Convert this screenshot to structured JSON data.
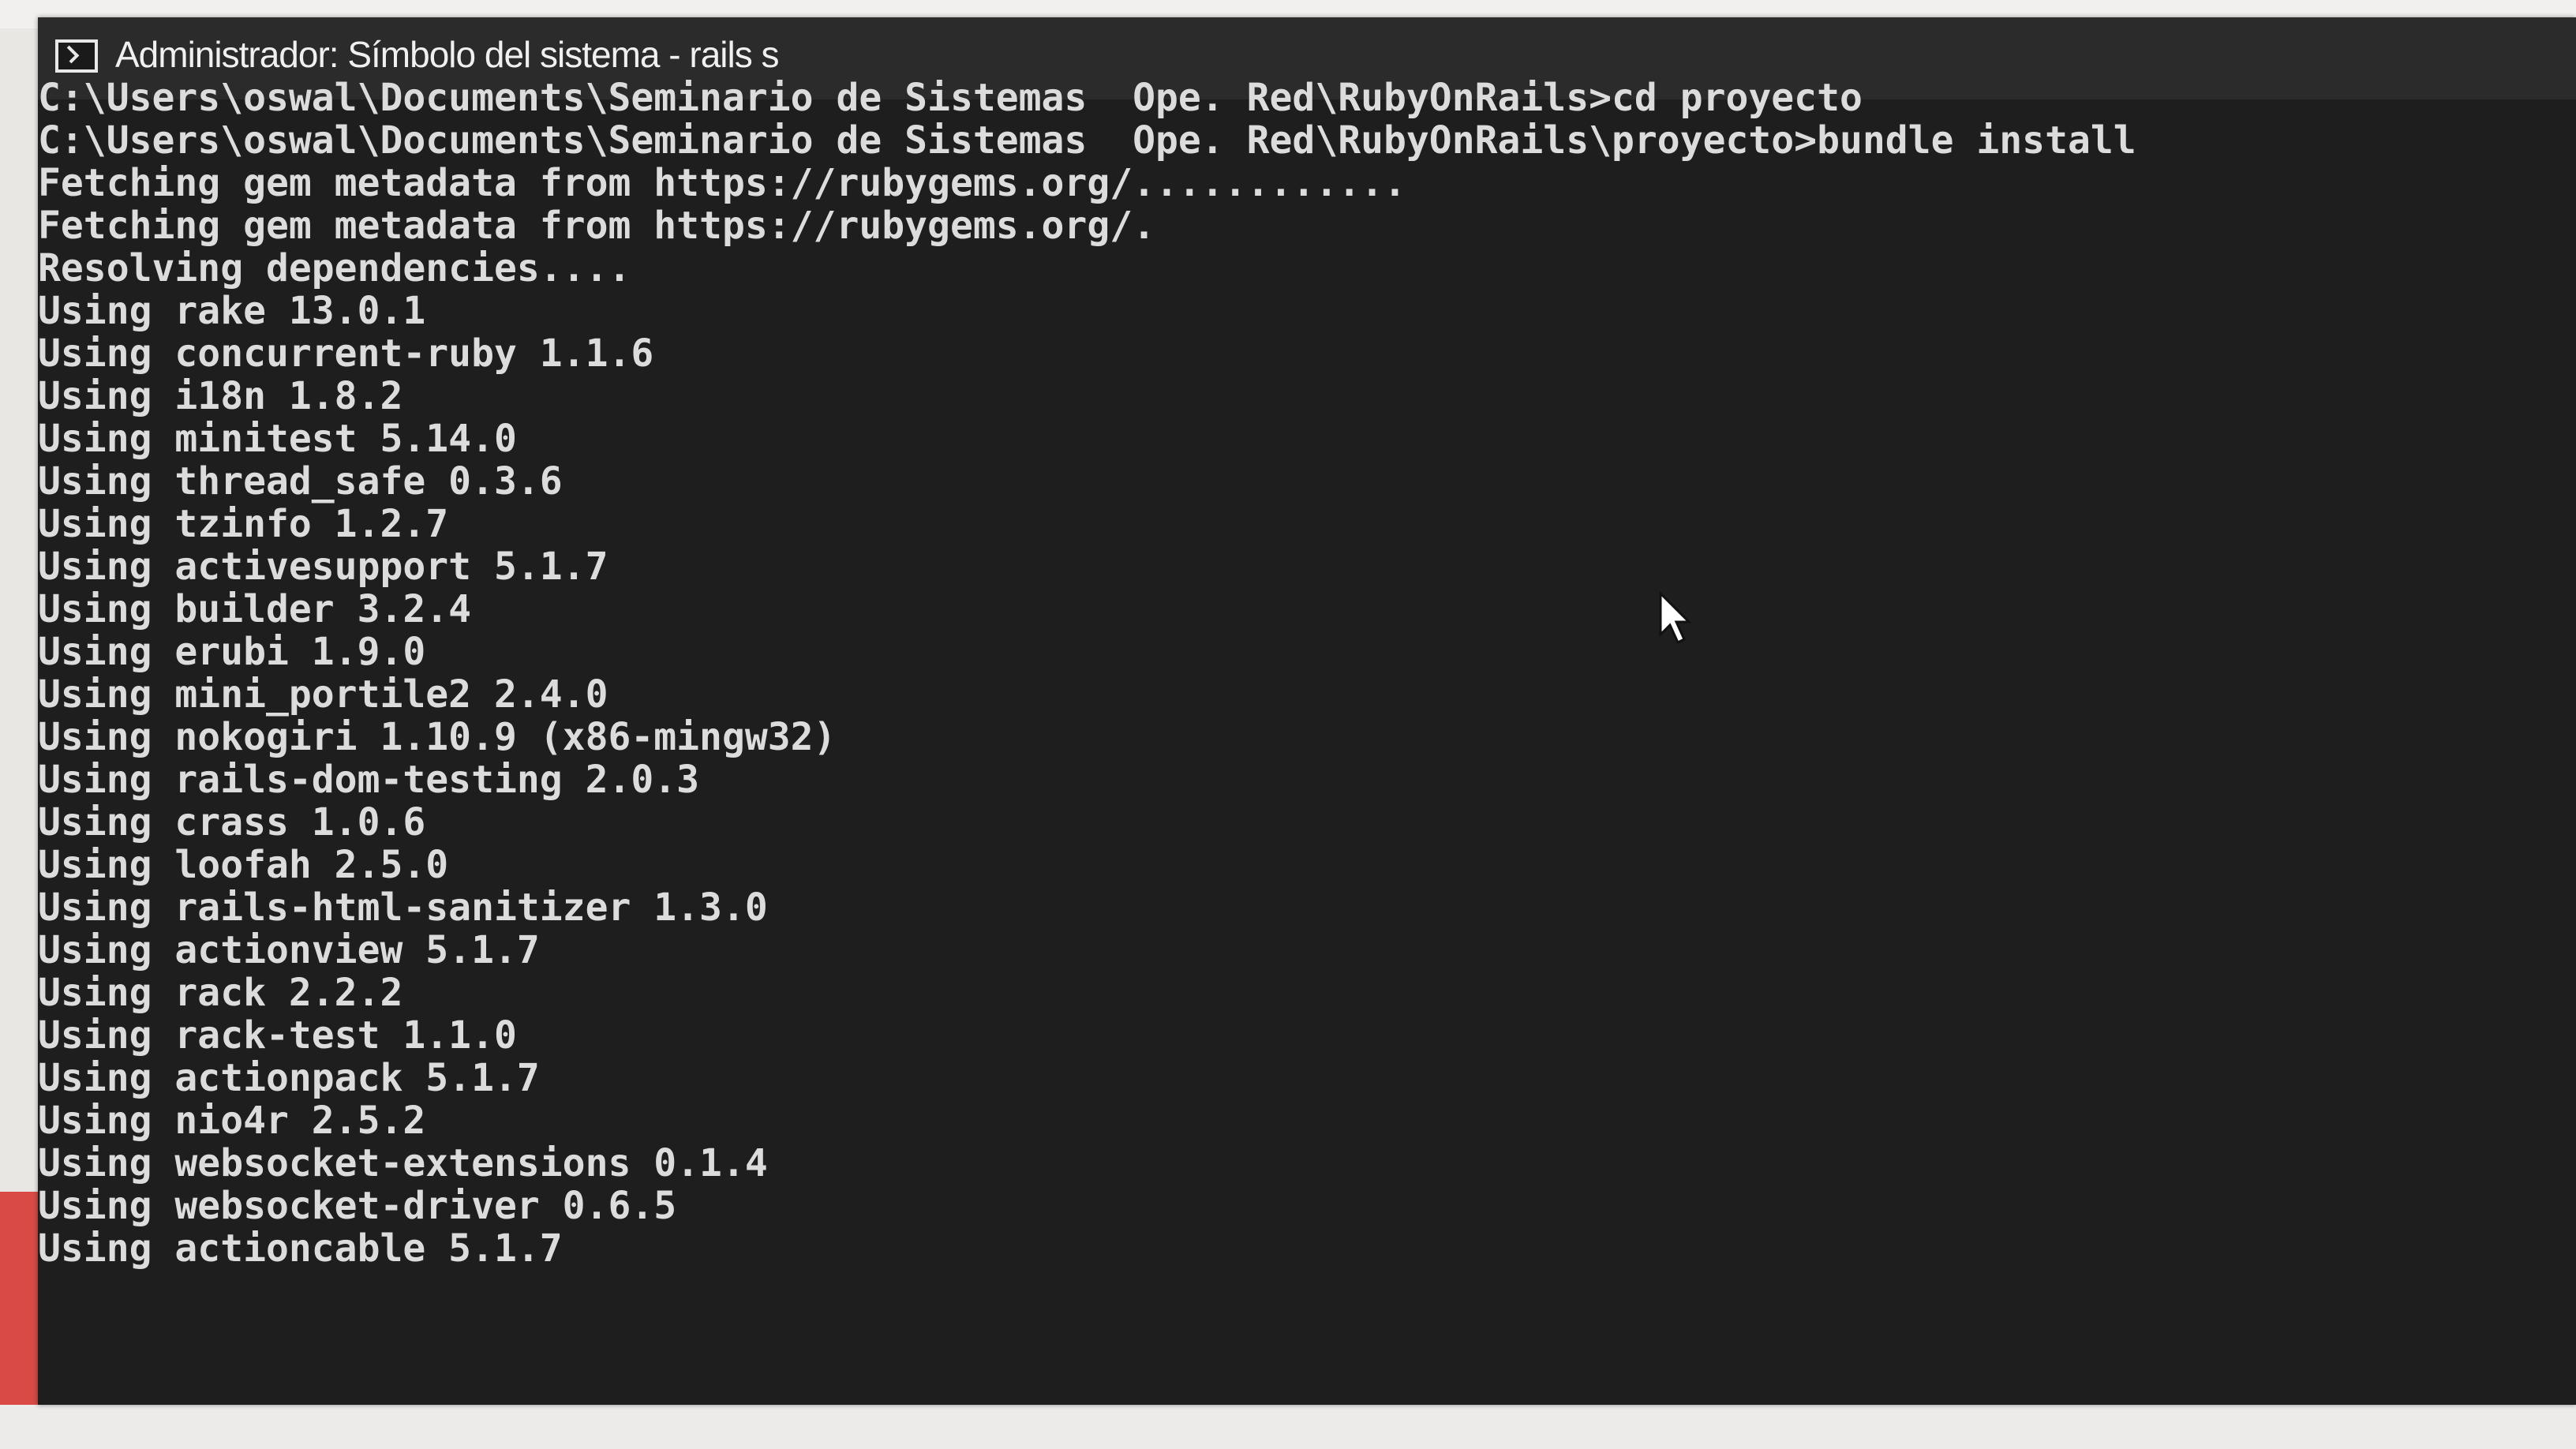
{
  "window": {
    "title": "Administrador: Símbolo del sistema - rails s"
  },
  "console": {
    "lines": [
      "C:\\Users\\oswal\\Documents\\Seminario de Sistemas  Ope. Red\\RubyOnRails>cd proyecto",
      "",
      "C:\\Users\\oswal\\Documents\\Seminario de Sistemas  Ope. Red\\RubyOnRails\\proyecto>bundle install",
      "Fetching gem metadata from https://rubygems.org/............",
      "Fetching gem metadata from https://rubygems.org/.",
      "Resolving dependencies....",
      "Using rake 13.0.1",
      "Using concurrent-ruby 1.1.6",
      "Using i18n 1.8.2",
      "Using minitest 5.14.0",
      "Using thread_safe 0.3.6",
      "Using tzinfo 1.2.7",
      "Using activesupport 5.1.7",
      "Using builder 3.2.4",
      "Using erubi 1.9.0",
      "Using mini_portile2 2.4.0",
      "Using nokogiri 1.10.9 (x86-mingw32)",
      "Using rails-dom-testing 2.0.3",
      "Using crass 1.0.6",
      "Using loofah 2.5.0",
      "Using rails-html-sanitizer 1.3.0",
      "Using actionview 5.1.7",
      "Using rack 2.2.2",
      "Using rack-test 1.1.0",
      "Using actionpack 5.1.7",
      "Using nio4r 2.5.2",
      "Using websocket-extensions 0.1.4",
      "Using websocket-driver 0.6.5",
      "Using actioncable 5.1.7"
    ]
  },
  "icons": {
    "app": "command-prompt-icon",
    "minimize": "minimize-icon",
    "maximize": "maximize-icon",
    "pointer": "mouse-pointer-icon"
  },
  "colors": {
    "console_bg": "#1e1e1e",
    "console_text": "#dcdcdc",
    "titlebar_bg": "#2b2b2b"
  }
}
